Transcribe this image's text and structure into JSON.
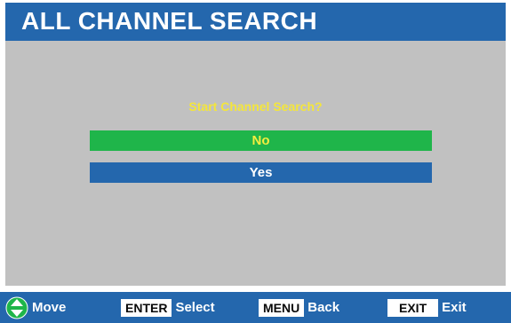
{
  "title": "ALL CHANNEL SEARCH",
  "prompt": "Start Channel Search?",
  "options": [
    {
      "label": "No",
      "selected": true
    },
    {
      "label": "Yes",
      "selected": false
    }
  ],
  "footer": {
    "hints": [
      {
        "icon": "move-arrows-icon",
        "label": "Move"
      },
      {
        "key": "ENTER",
        "label": "Select"
      },
      {
        "key": "MENU",
        "label": "Back"
      },
      {
        "key": "EXIT",
        "label": "Exit"
      }
    ]
  },
  "colors": {
    "title_bar": "#2467ad",
    "panel_bg": "#c1c1c1",
    "selected_bg": "#1fb54a",
    "selected_text": "#f3ed3f",
    "prompt_text": "#f4e63b",
    "unselected_bg": "#2467ad"
  }
}
